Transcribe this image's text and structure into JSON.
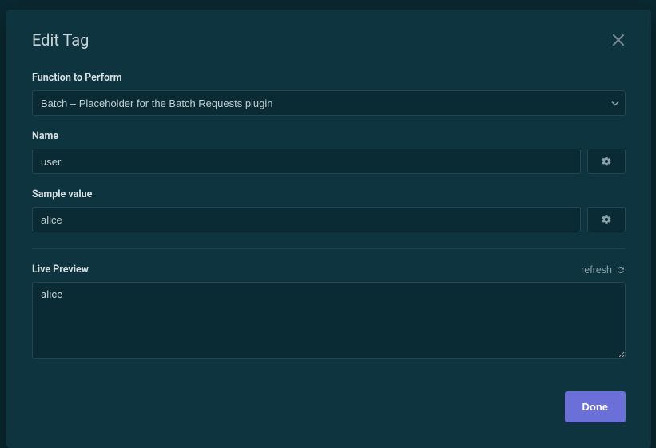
{
  "modal": {
    "title": "Edit Tag",
    "function_label": "Function to Perform",
    "function_value": "Batch – Placeholder for the Batch Requests plugin",
    "name_label": "Name",
    "name_value": "user",
    "sample_label": "Sample value",
    "sample_value": "alice",
    "preview_label": "Live Preview",
    "refresh_label": "refresh",
    "preview_value": "alice",
    "done_label": "Done"
  }
}
